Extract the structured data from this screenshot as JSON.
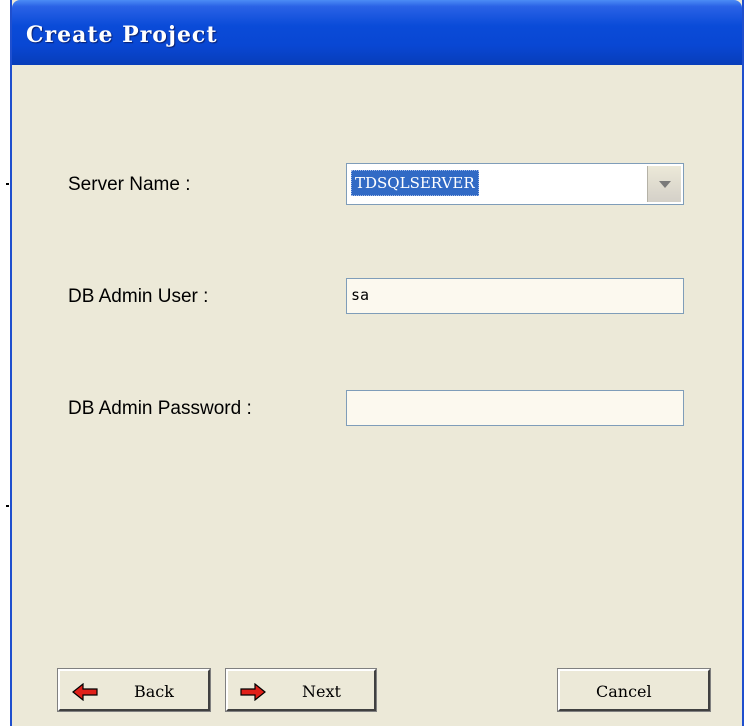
{
  "window": {
    "title": "Create Project"
  },
  "form": {
    "server_name_label": "Server Name :",
    "server_name_value": "TDSQLSERVER",
    "db_admin_user_label": "DB Admin User :",
    "db_admin_user_value": "sa",
    "db_admin_password_label": "DB Admin Password :",
    "db_admin_password_value": ""
  },
  "buttons": {
    "back_label": "Back",
    "next_label": "Next",
    "cancel_label": "Cancel"
  },
  "icons": {
    "back": "arrow-left-icon",
    "next": "arrow-right-icon",
    "dropdown": "chevron-down-icon"
  },
  "colors": {
    "titlebar": "#0a4bd8",
    "window_bg": "#ece9d8",
    "selection": "#316ac5",
    "arrow_red": "#e0201a"
  }
}
